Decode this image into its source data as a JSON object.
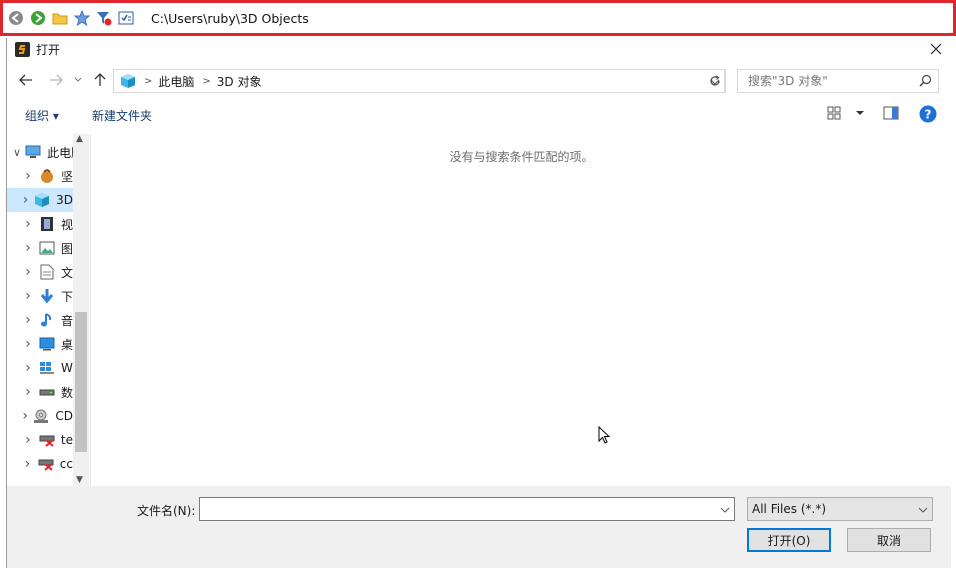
{
  "toolbar": {
    "path": "C:\\Users\\ruby\\3D Objects",
    "icons": [
      "back-globe-icon",
      "forward-globe-icon",
      "folder-icon",
      "star-icon",
      "filter-icon",
      "checklist-icon"
    ]
  },
  "dialog": {
    "title": "打开",
    "address": {
      "crumbs": [
        "此电脑",
        "3D 对象"
      ]
    },
    "search": {
      "placeholder": "搜索\"3D 对象\""
    },
    "commands": {
      "organize": "组织 ▾",
      "new_folder": "新建文件夹"
    },
    "tree": [
      {
        "label": "此电脑",
        "icon": "computer-icon",
        "expanded": true
      },
      {
        "label": "坚",
        "icon": "nut-icon"
      },
      {
        "label": "3D",
        "icon": "cube-icon",
        "selected": true
      },
      {
        "label": "视",
        "icon": "film-icon"
      },
      {
        "label": "图",
        "icon": "picture-icon"
      },
      {
        "label": "文",
        "icon": "document-icon"
      },
      {
        "label": "下",
        "icon": "download-arrow-icon"
      },
      {
        "label": "音",
        "icon": "music-note-icon"
      },
      {
        "label": "桌",
        "icon": "desktop-icon"
      },
      {
        "label": "W",
        "icon": "windows-drive-icon"
      },
      {
        "label": "数",
        "icon": "drive-icon"
      },
      {
        "label": "CD",
        "icon": "cd-drive-icon"
      },
      {
        "label": "te",
        "icon": "network-drive-error-icon"
      },
      {
        "label": "cc",
        "icon": "network-drive-error-icon"
      }
    ],
    "empty_message": "没有与搜索条件匹配的项。",
    "filename_label": "文件名(N):",
    "filename_value": "",
    "filter_value": "All Files (*.*)",
    "open_button": "打开(O)",
    "cancel_button": "取消"
  },
  "colors": {
    "toolbar_border": "#e0262b",
    "selected": "#cce8ff",
    "accent": "#0078d7"
  }
}
